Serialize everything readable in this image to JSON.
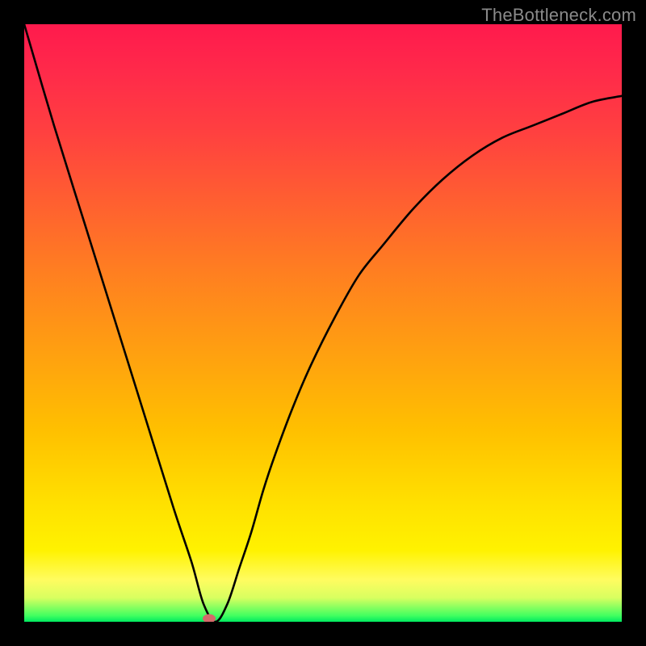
{
  "watermark": "TheBottleneck.com",
  "chart_data": {
    "type": "line",
    "title": "",
    "xlabel": "",
    "ylabel": "",
    "xlim": [
      0,
      100
    ],
    "ylim": [
      0,
      100
    ],
    "series": [
      {
        "name": "curve",
        "x": [
          0,
          5,
          10,
          15,
          20,
          25,
          28,
          30,
          32,
          34,
          36,
          38,
          40,
          42,
          45,
          48,
          52,
          56,
          60,
          65,
          70,
          75,
          80,
          85,
          90,
          95,
          100
        ],
        "y": [
          100,
          83,
          67,
          51,
          35,
          19,
          10,
          3,
          0,
          3,
          9,
          15,
          22,
          28,
          36,
          43,
          51,
          58,
          63,
          69,
          74,
          78,
          81,
          83,
          85,
          87,
          88
        ]
      }
    ],
    "marker": {
      "x": 31,
      "y": 0.5,
      "color": "#d46a6a"
    },
    "gradient_colors": [
      "#ff1a4d",
      "#ff6030",
      "#ffa010",
      "#ffe000",
      "#fffc60",
      "#40ff60",
      "#00e860"
    ]
  }
}
